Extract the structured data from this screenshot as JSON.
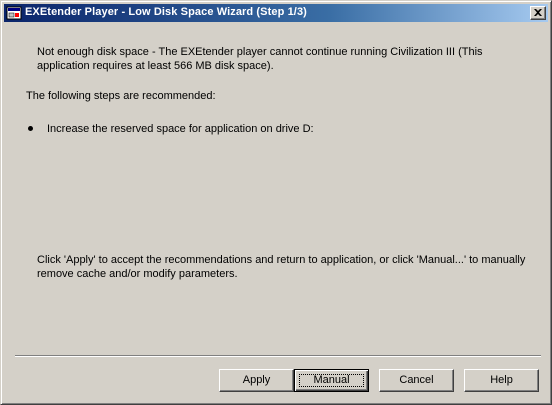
{
  "window": {
    "title": "EXEtender Player - Low Disk Space Wizard (Step 1/3)",
    "icons": {
      "app": "app-icon",
      "close": "close-icon"
    }
  },
  "content": {
    "message": "Not enough disk space - The EXEtender player cannot continue running Civilization III (This application requires at least 566 MB disk space).",
    "steps_heading": "The following steps are recommended:",
    "steps": [
      "Increase the reserved space for application on drive D:"
    ],
    "hint": "Click 'Apply' to accept the recommendations and return to application, or click 'Manual...' to manually remove cache and/or modify parameters."
  },
  "buttons": {
    "apply": "Apply",
    "manual": "Manual",
    "cancel": "Cancel",
    "help": "Help"
  },
  "colors": {
    "titlebar_start": "#0a246a",
    "titlebar_end": "#a6caf0",
    "face": "#d4d0c8"
  }
}
